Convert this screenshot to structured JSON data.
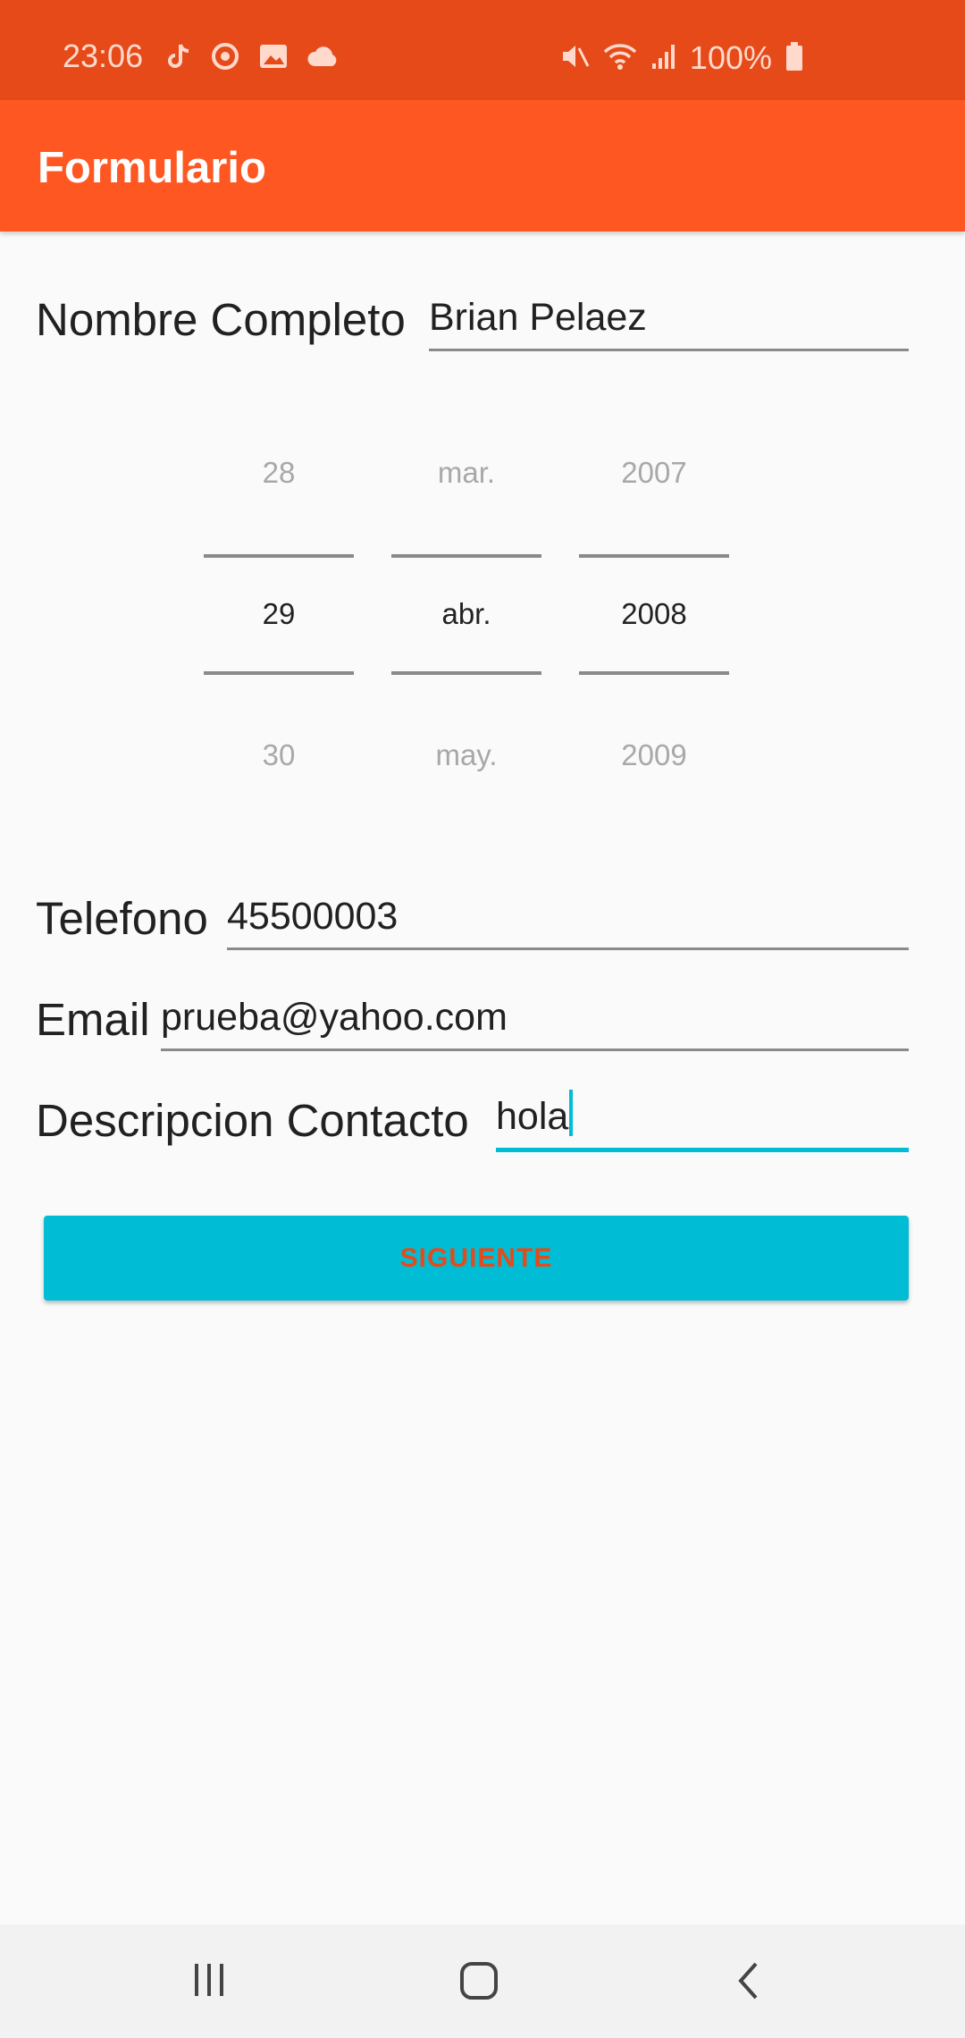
{
  "status_bar": {
    "time": "23:06",
    "battery": "100%",
    "left_icons": [
      "tiktok-icon",
      "sync-icon",
      "image-icon",
      "cloud-icon"
    ],
    "right_icons": [
      "mute-icon",
      "wifi-icon",
      "signal-icon",
      "battery-icon"
    ]
  },
  "app_bar": {
    "title": "Formulario"
  },
  "form": {
    "name": {
      "label": "Nombre Completo",
      "value": "Brian Pelaez"
    },
    "date_picker": {
      "day": {
        "prev": "28",
        "selected": "29",
        "next": "30"
      },
      "month": {
        "prev": "mar.",
        "selected": "abr.",
        "next": "may."
      },
      "year": {
        "prev": "2007",
        "selected": "2008",
        "next": "2009"
      }
    },
    "phone": {
      "label": "Telefono",
      "value": "45500003"
    },
    "email": {
      "label": "Email",
      "value": "prueba@yahoo.com"
    },
    "description": {
      "label": "Descripcion Contacto",
      "value": "hola"
    }
  },
  "next_button": {
    "label": "SIGUIENTE"
  },
  "nav_bar": {
    "icons": [
      "recents-icon",
      "home-icon",
      "back-icon"
    ]
  },
  "colors": {
    "status_bar": "#e64a19",
    "app_bar": "#ff5722",
    "accent": "#00bcd4",
    "button_text": "#e64a19"
  }
}
